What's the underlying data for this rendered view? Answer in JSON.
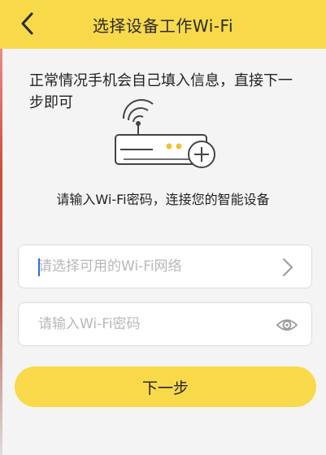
{
  "header": {
    "title": "选择设备工作Wi-Fi",
    "back_icon": "chevron-left-icon"
  },
  "hint_text": "正常情况手机会自己填入信息，直接下一步即可",
  "device_icon": "router-add-icon",
  "subtitle": "请输入Wi-Fi密码，连接您的智能设备",
  "wifi_field": {
    "value": "",
    "placeholder": "请选择可用的Wi-Fi网络",
    "icon": "chevron-right-icon"
  },
  "password_field": {
    "value": "",
    "placeholder": "请输入Wi-Fi密码",
    "icon": "eye-icon"
  },
  "next_button": {
    "label": "下一步"
  },
  "colors": {
    "accent": "#f8d94a",
    "background": "#f4f4f4",
    "cursor": "#2a6ee8"
  }
}
